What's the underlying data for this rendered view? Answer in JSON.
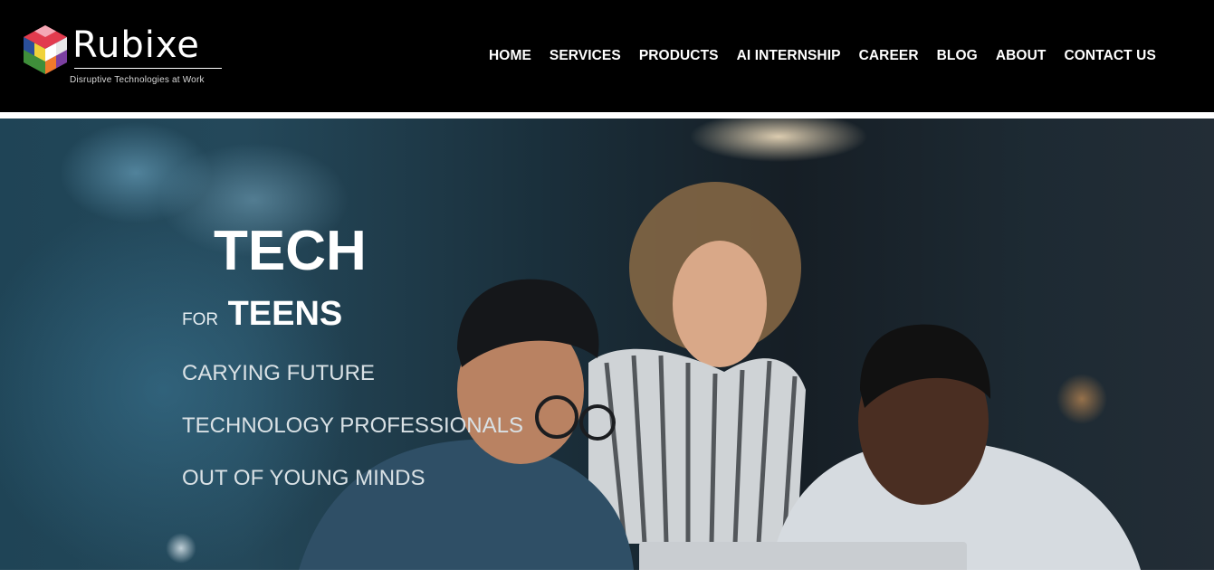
{
  "brand": {
    "name": "Rubixe",
    "tagline": "Disruptive Technologies at Work",
    "logo_icon": "hexagon-cube-logo"
  },
  "nav": {
    "items": [
      {
        "label": "HOME"
      },
      {
        "label": "SERVICES"
      },
      {
        "label": "PRODUCTS"
      },
      {
        "label": "AI INTERNSHIP"
      },
      {
        "label": "CAREER"
      },
      {
        "label": "BLOG"
      },
      {
        "label": "ABOUT"
      },
      {
        "label": "CONTACT US"
      }
    ]
  },
  "hero": {
    "heading_main": "TECH",
    "heading_prefix": "FOR",
    "heading_sub": "TEENS",
    "lines": [
      "CARYING FUTURE",
      "TECHNOLOGY PROFESSIONALS",
      "OUT OF YOUNG MINDS"
    ]
  },
  "colors": {
    "header_bg": "#000000",
    "text_primary": "#ffffff",
    "hero_text_muted": "#d9e1e5",
    "hero_blue": "#24485a"
  }
}
